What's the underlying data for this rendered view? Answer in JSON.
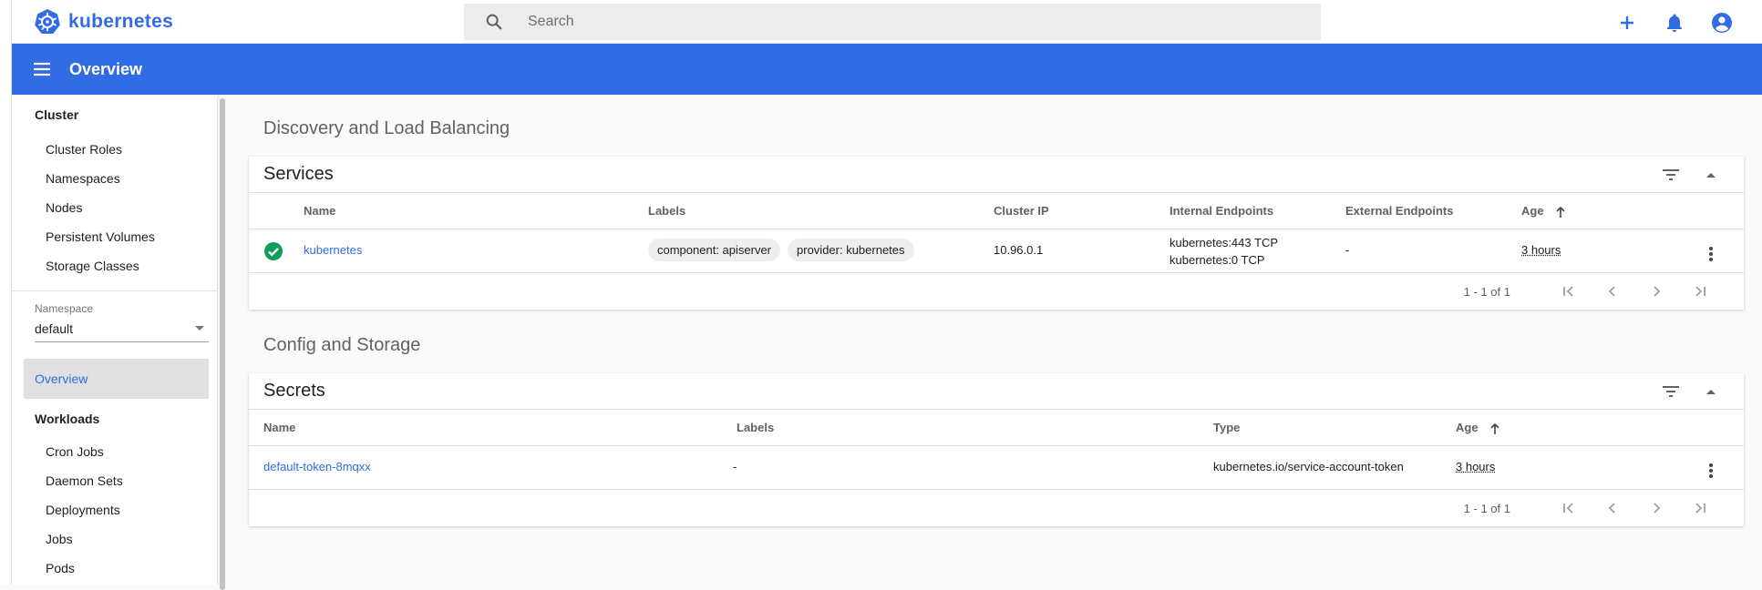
{
  "brand": {
    "name": "kubernetes"
  },
  "search": {
    "placeholder": "Search"
  },
  "appbar": {
    "title": "Overview"
  },
  "sidebar": {
    "cluster_heading": "Cluster",
    "cluster_items": [
      "Cluster Roles",
      "Namespaces",
      "Nodes",
      "Persistent Volumes",
      "Storage Classes"
    ],
    "namespace_label": "Namespace",
    "namespace_value": "default",
    "active_item": "Overview",
    "workloads_heading": "Workloads",
    "workload_items": [
      "Cron Jobs",
      "Daemon Sets",
      "Deployments",
      "Jobs",
      "Pods"
    ]
  },
  "discovery": {
    "section_title": "Discovery and Load Balancing",
    "services": {
      "title": "Services",
      "columns": {
        "name": "Name",
        "labels": "Labels",
        "cluster_ip": "Cluster IP",
        "internal": "Internal Endpoints",
        "external": "External Endpoints",
        "age": "Age"
      },
      "rows": [
        {
          "name": "kubernetes",
          "labels": [
            "component: apiserver",
            "provider: kubernetes"
          ],
          "cluster_ip": "10.96.0.1",
          "internal_1": "kubernetes:443 TCP",
          "internal_2": "kubernetes:0 TCP",
          "external": "-",
          "age": "3 hours"
        }
      ],
      "pager": "1 - 1 of 1"
    }
  },
  "config": {
    "section_title": "Config and Storage",
    "secrets": {
      "title": "Secrets",
      "columns": {
        "name": "Name",
        "labels": "Labels",
        "type": "Type",
        "age": "Age"
      },
      "rows": [
        {
          "name": "default-token-8mqxx",
          "labels": "-",
          "type": "kubernetes.io/service-account-token",
          "age": "3 hours"
        }
      ],
      "pager": "1 - 1 of 1"
    }
  },
  "colors": {
    "brand": "#326ce5",
    "success": "#0f9d58",
    "text": "#212121"
  }
}
